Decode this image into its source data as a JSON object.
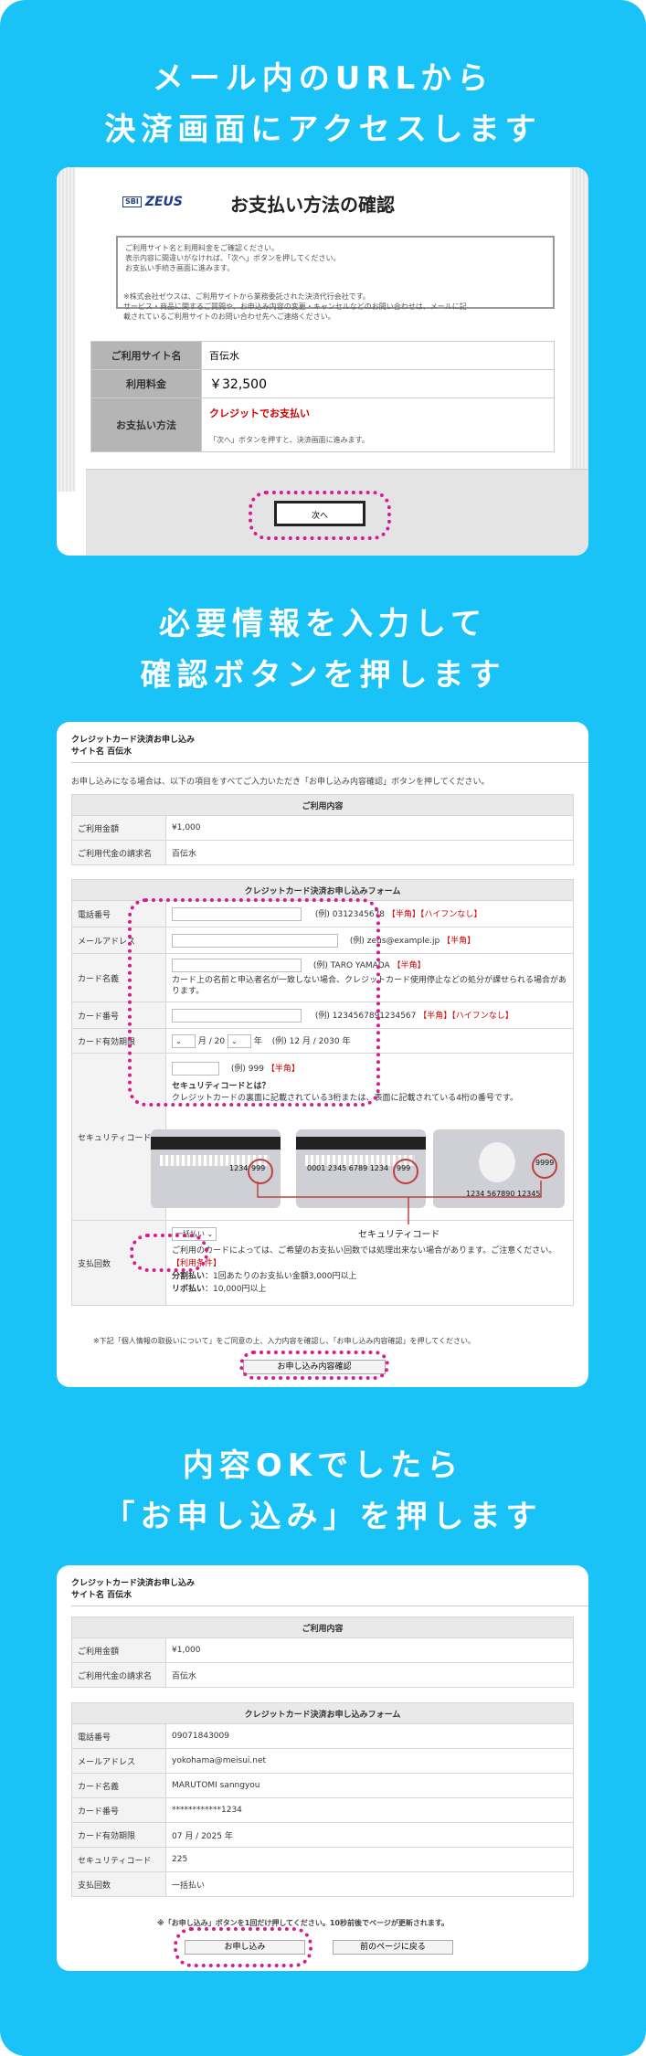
{
  "headings": {
    "step1_line1": "メール内のURLから",
    "step1_line2": "決済画面にアクセスします",
    "step2_line1": "必要情報を入力して",
    "step2_line2": "確認ボタンを押します",
    "step3_line1": "内容OKでしたら",
    "step3_line2": "「お申し込み」を押します"
  },
  "colors": {
    "background": "#19c3f7",
    "highlight": "#d81b8e",
    "required": "#d10000"
  },
  "screen1": {
    "logo_sbi": "SBI",
    "logo_zeus": "ZEUS",
    "title": "お支払い方法の確認",
    "notice_lines": [
      "ご利用サイト名と利用料金をご確認ください。",
      "表示内容に間違いがなければ、「次へ」ボタンを押してください。",
      "お支払い手続き画面に進みます。",
      "",
      "※株式会社ゼウスは、ご利用サイトから業務委託された決済代行会社です。",
      "サービス・商品に関するご質問や、お申込み内容の変更・キャンセルなどのお問い合わせは、メールに記",
      "載されているご利用サイトのお問い合わせ先へご連絡ください。"
    ],
    "rows": [
      {
        "label": "ご利用サイト名",
        "value": "百伝水"
      },
      {
        "label": "利用料金",
        "value": "￥32,500"
      },
      {
        "label": "お支払い方法",
        "value": "クレジットでお支払い",
        "note": "「次へ」ボタンを押すと、決済画面に進みます。"
      }
    ],
    "next_button": "次へ"
  },
  "screen2": {
    "header_line1": "クレジットカード決済お申し込み",
    "header_line2": "サイト名 百伝水",
    "instruction": "お申し込みになる場合は、以下の項目をすべてご入力いただき「お申し込み内容確認」ボタンを押してください。",
    "usage_title": "ご利用内容",
    "usage_rows": [
      {
        "label": "ご利用金額",
        "value": "¥1,000"
      },
      {
        "label": "ご利用代金の請求名",
        "value": "百伝水"
      }
    ],
    "form_title": "クレジットカード決済お申し込みフォーム",
    "phone_label": "電話番号",
    "phone_example": "(例) 0312345678",
    "phone_hint1": "【半角】",
    "phone_hint2": "【ハイフンなし】",
    "email_label": "メールアドレス",
    "email_example": "(例) zeus@example.jp",
    "email_hint": "【半角】",
    "name_label": "カード名義",
    "name_example": "(例) TARO YAMADA",
    "name_hint": "【半角】",
    "name_warning": "カード上の名前と申込者名が一致しない場合、クレジットカード使用停止などの処分が課せられる場合があります。",
    "number_label": "カード番号",
    "number_example": "(例) 1234567891234567",
    "number_hint1": "【半角】",
    "number_hint2": "【ハイフンなし】",
    "expiry_label": "カード有効期限",
    "expiry_month_sep": "月 / 20",
    "expiry_year_sep": "年",
    "expiry_example": "(例) 12 月 / 2030 年",
    "cvv_label": "セキュリティコード",
    "cvv_example": "(例) 999",
    "cvv_hint": "【半角】",
    "cvv_question": "セキュリティコードとは？",
    "cvv_desc": "クレジットカードの裏面に記載されている3桁または、表面に記載されている4桁の番号です。",
    "card1_num": "1234",
    "card1_code": "999",
    "card2_num": "0001 2345 6789 1234",
    "card2_code": "999",
    "card3_code": "9999",
    "card3_num": "1234 567890 12345",
    "cvv_caption": "セキュリティコード",
    "installments_label": "支払回数",
    "installments_value": "一括払い",
    "installments_note": "ご利用のカードによっては、ご希望のお支払い回数では処理出来ない場合があります。ご注意ください。",
    "conditions_title": "【利用条件】",
    "condition1_label": "分割払い",
    "condition1": "：1回あたりのお支払い金額3,000円以上",
    "condition2_label": "リボ払い",
    "condition2": "：10,000円以上",
    "privacy_note": "※下記「個人情報の取扱いについて」をご同意の上、入力内容を確認し、「お申し込み内容確認」を押してください。",
    "confirm_button": "お申し込み内容確認"
  },
  "screen3": {
    "header_line1": "クレジットカード決済お申し込み",
    "header_line2": "サイト名 百伝水",
    "usage_title": "ご利用内容",
    "usage_rows": [
      {
        "label": "ご利用金額",
        "value": "¥1,000"
      },
      {
        "label": "ご利用代金の請求名",
        "value": "百伝水"
      }
    ],
    "form_title": "クレジットカード決済お申し込みフォーム",
    "rows": [
      {
        "label": "電話番号",
        "value": "09071843009"
      },
      {
        "label": "メールアドレス",
        "value": "yokohama@meisui.net"
      },
      {
        "label": "カード名義",
        "value": "MARUTOMI sanngyou"
      },
      {
        "label": "カード番号",
        "value": "************1234"
      },
      {
        "label": "カード有効期限",
        "value": "07 月 / 2025 年"
      },
      {
        "label": "セキュリティコード",
        "value": "225"
      },
      {
        "label": "支払回数",
        "value": "一括払い"
      }
    ],
    "notice": "※「お申し込み」ボタンを1回だけ押してください。10秒前後でページが更新されます。",
    "submit_button": "お申し込み",
    "back_button": "前のページに戻る"
  }
}
